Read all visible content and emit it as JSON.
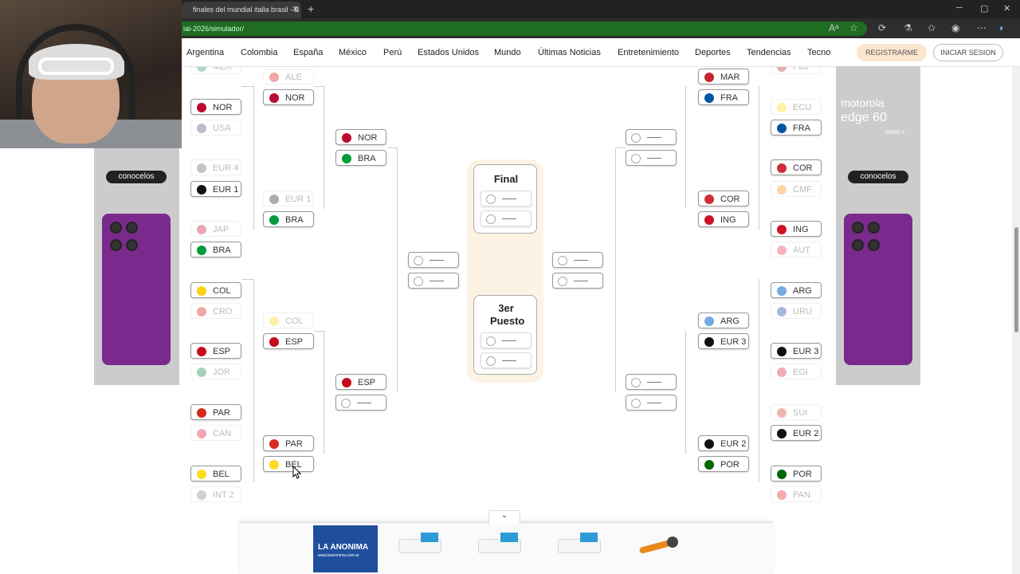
{
  "browser": {
    "tab_title": "finales del mundial italia brasil - B",
    "tab_close": "✕",
    "new_tab": "+",
    "url": "ial-2026/simulador/",
    "controls": {
      "minimize": "─",
      "maximize": "▢",
      "close": "✕"
    }
  },
  "nav": {
    "items": [
      "Argentina",
      "Colombia",
      "España",
      "México",
      "Perú",
      "Estados Unidos",
      "Mundo",
      "Últimas Noticias",
      "Entretenimiento",
      "Deportes",
      "Tendencias",
      "Tecno"
    ],
    "register": "REGISTRARME",
    "login": "INICIAR SESION"
  },
  "ads": {
    "brand": "motorola",
    "model": "edge 60",
    "family": "FAMILY",
    "cta": "conocelos",
    "bottom_logo": "LA ANONIMA",
    "bottom_url": "www.laanonima.com.ar"
  },
  "bracket": {
    "left_r1": [
      {
        "code": "MEX",
        "faded": true,
        "color": "#2e8b57"
      },
      {
        "code": "NOR",
        "faded": false,
        "color": "#ba0c2f"
      },
      {
        "code": "USA",
        "faded": true,
        "color": "#3c3b6e"
      },
      {
        "code": "EUR 4",
        "faded": true,
        "color": "#555"
      },
      {
        "code": "EUR 1",
        "faded": false,
        "color": "#111"
      },
      {
        "code": "JAP",
        "faded": true,
        "color": "#bc002d"
      },
      {
        "code": "BRA",
        "faded": false,
        "color": "#009c3b"
      },
      {
        "code": "COL",
        "faded": false,
        "color": "#fcd116"
      },
      {
        "code": "CRO",
        "faded": true,
        "color": "#d00"
      },
      {
        "code": "ESP",
        "faded": false,
        "color": "#c60b1e"
      },
      {
        "code": "JOR",
        "faded": true,
        "color": "#007a3d"
      },
      {
        "code": "PAR",
        "faded": false,
        "color": "#d52b1e"
      },
      {
        "code": "CAN",
        "faded": true,
        "color": "#d80621"
      },
      {
        "code": "BEL",
        "faded": false,
        "color": "#fdda24"
      },
      {
        "code": "INT 2",
        "faded": true,
        "color": "#777"
      }
    ],
    "left_r2": [
      {
        "code": "ALE",
        "faded": true,
        "color": "#dd0000"
      },
      {
        "code": "NOR",
        "faded": false,
        "color": "#ba0c2f"
      },
      {
        "code": "EUR 1",
        "faded": true,
        "color": "#111"
      },
      {
        "code": "BRA",
        "faded": false,
        "color": "#009c3b"
      },
      {
        "code": "COL",
        "faded": true,
        "color": "#fcd116"
      },
      {
        "code": "ESP",
        "faded": false,
        "color": "#c60b1e"
      },
      {
        "code": "PAR",
        "faded": false,
        "color": "#d52b1e"
      },
      {
        "code": "BEL",
        "faded": false,
        "color": "#fdda24"
      }
    ],
    "left_r3": [
      {
        "code": "NOR",
        "faded": false,
        "color": "#ba0c2f"
      },
      {
        "code": "BRA",
        "faded": false,
        "color": "#009c3b"
      },
      {
        "code": "ESP",
        "faded": false,
        "color": "#c60b1e"
      }
    ],
    "right_r1": [
      {
        "code": "PBJ",
        "faded": true,
        "color": "#ae1c28"
      },
      {
        "code": "ECU",
        "faded": true,
        "color": "#ffdd00"
      },
      {
        "code": "FRA",
        "faded": false,
        "color": "#0055a4"
      },
      {
        "code": "COR",
        "faded": false,
        "color": "#cd2e3a"
      },
      {
        "code": "CMF",
        "faded": true,
        "color": "#ff8200"
      },
      {
        "code": "ING",
        "faded": false,
        "color": "#ce1124"
      },
      {
        "code": "AUT",
        "faded": true,
        "color": "#ed2939"
      },
      {
        "code": "ARG",
        "faded": false,
        "color": "#74acdf"
      },
      {
        "code": "URU",
        "faded": true,
        "color": "#0038a8"
      },
      {
        "code": "EUR 3",
        "faded": false,
        "color": "#111"
      },
      {
        "code": "EGI",
        "faded": true,
        "color": "#ce1126"
      },
      {
        "code": "SUI",
        "faded": true,
        "color": "#d52b1e"
      },
      {
        "code": "EUR 2",
        "faded": false,
        "color": "#111"
      },
      {
        "code": "POR",
        "faded": false,
        "color": "#006600"
      },
      {
        "code": "PAN",
        "faded": true,
        "color": "#da121a"
      }
    ],
    "right_r2": [
      {
        "code": "MAR",
        "faded": false,
        "color": "#c1272d"
      },
      {
        "code": "FRA",
        "faded": false,
        "color": "#0055a4"
      },
      {
        "code": "COR",
        "faded": false,
        "color": "#cd2e3a"
      },
      {
        "code": "ING",
        "faded": false,
        "color": "#ce1124"
      },
      {
        "code": "ARG",
        "faded": false,
        "color": "#74acdf"
      },
      {
        "code": "EUR 3",
        "faded": false,
        "color": "#111"
      },
      {
        "code": "EUR 2",
        "faded": false,
        "color": "#111"
      },
      {
        "code": "POR",
        "faded": false,
        "color": "#006600"
      }
    ],
    "final_title": "Final",
    "third_title": "3er Puesto",
    "placeholder": "___"
  }
}
